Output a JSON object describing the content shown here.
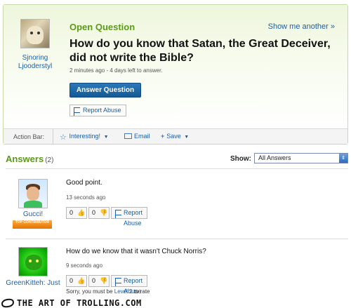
{
  "question": {
    "heading": "Open Question",
    "show_another": "Show me another »",
    "title": "How do you know that Satan, the Great Deceiver, did not write the Bible?",
    "meta": "2 minutes ago - 4 days left to answer.",
    "answer_button": "Answer Question",
    "report_abuse": "Report Abuse",
    "asker": {
      "name": "Sjnoring Ljooderstyl",
      "avatar_icon": "dog-photo-avatar"
    }
  },
  "action_bar": {
    "label": "Action Bar:",
    "interesting": "Interesting!",
    "email": "Email",
    "save": "Save"
  },
  "answers": {
    "heading": "Answers",
    "count": "(2)",
    "show_label": "Show:",
    "show_selected": "All Answers",
    "items": [
      {
        "user": "Gucci!",
        "badge": "TOP CONTRIBUTOR",
        "text": "Good point.",
        "time": "13 seconds ago",
        "thumbs_up": "0",
        "thumbs_down": "0",
        "report": "Report Abuse"
      },
      {
        "user": "GreenKitteh: Just",
        "text": "How do we know that it wasn't Chuck Norris?",
        "time": "9 seconds ago",
        "thumbs_up": "0",
        "thumbs_down": "0",
        "report": "Report Abuse",
        "notice_prefix": "Sorry, you must be",
        "notice_link": "Level 2",
        "notice_suffix": "to rate"
      }
    ]
  },
  "watermark": "THE ART OF TROLLING.COM",
  "colors": {
    "accent_green": "#5a9a18",
    "link_blue": "#1a5fa8",
    "button_blue": "#145a96",
    "badge_orange": "#e27600"
  }
}
